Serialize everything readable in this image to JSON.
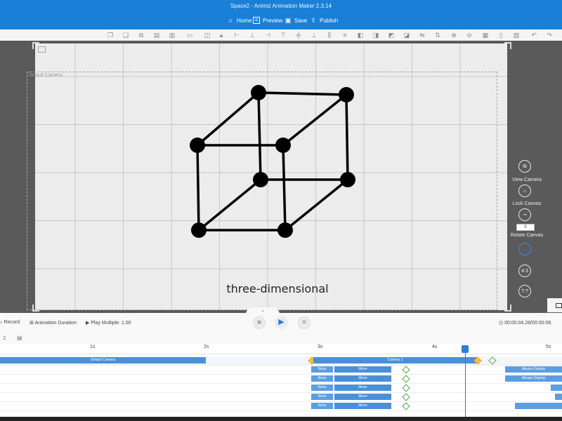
{
  "app": {
    "title": "Space2 - Animiz Animation Maker 2.3.14"
  },
  "menu": {
    "items": [
      {
        "label": "Home",
        "icon": "home-icon"
      },
      {
        "label": "Preview",
        "icon": "preview-icon"
      },
      {
        "label": "Save",
        "icon": "save-icon"
      },
      {
        "label": "Publish",
        "icon": "publish-icon"
      }
    ]
  },
  "canvas": {
    "camera_label": "Default Camera",
    "caption": "three-dimensional",
    "background_color": "#ececec",
    "shape": "cube-wireframe"
  },
  "right_panel": {
    "view_camera": "View Camera",
    "lock_canvas": "Lock Canvas",
    "rotate_canvas": "Rotate Canvas",
    "rotate_value": "0",
    "ratio_43": "4:3",
    "ratio_unknown": "?:?"
  },
  "controls": {
    "record": "Record",
    "animation_duration": "Animation Duration",
    "play_multiple": "Play Multiple: 1.00",
    "time": "00:00:04.28/00:00:06."
  },
  "timeline": {
    "ticks": [
      "1s",
      "2s",
      "3s",
      "4s",
      "5s"
    ],
    "default_camera": "Default Camera",
    "camera1": "Camera 1",
    "rows": [
      {
        "in": "None",
        "effect": "Move",
        "out": "Always Display"
      },
      {
        "in": "None",
        "effect": "Move",
        "out": "Always Display"
      },
      {
        "in": "None",
        "effect": "Move",
        "out": ""
      },
      {
        "in": "None",
        "effect": "Move",
        "out": ""
      },
      {
        "in": "None",
        "effect": "Move",
        "out": ""
      }
    ],
    "playhead_seconds": 4.28
  },
  "colors": {
    "titlebar": "#1a7fd6",
    "accent": "#2d7fd3",
    "playhead": "#e33333",
    "keyframe": "#4aa845"
  }
}
